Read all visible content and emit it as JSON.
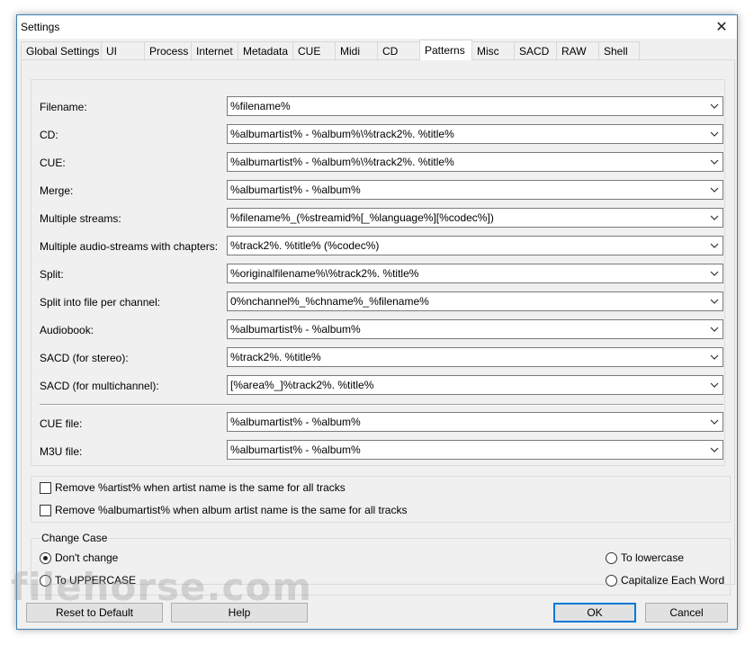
{
  "window": {
    "title": "Settings"
  },
  "tabs": [
    {
      "label": "Global Settings"
    },
    {
      "label": "UI"
    },
    {
      "label": "Process"
    },
    {
      "label": "Internet"
    },
    {
      "label": "Metadata"
    },
    {
      "label": "CUE"
    },
    {
      "label": "Midi"
    },
    {
      "label": "CD"
    },
    {
      "label": "Patterns",
      "active": true
    },
    {
      "label": "Misc"
    },
    {
      "label": "SACD"
    },
    {
      "label": "RAW"
    },
    {
      "label": "Shell"
    }
  ],
  "patterns": [
    {
      "label": "Filename:",
      "value": "%filename%"
    },
    {
      "label": "CD:",
      "value": "%albumartist% - %album%\\%track2%. %title%"
    },
    {
      "label": "CUE:",
      "value": "%albumartist% - %album%\\%track2%. %title%"
    },
    {
      "label": "Merge:",
      "value": "%albumartist% - %album%"
    },
    {
      "label": "Multiple streams:",
      "value": "%filename%_(%streamid%[_%language%][%codec%])"
    },
    {
      "label": "Multiple audio-streams with chapters:",
      "value": "%track2%. %title% (%codec%)"
    },
    {
      "label": "Split:",
      "value": "%originalfilename%\\%track2%. %title%"
    },
    {
      "label": "Split into file per channel:",
      "value": "0%nchannel%_%chname%_%filename%"
    },
    {
      "label": "Audiobook:",
      "value": "%albumartist% - %album%"
    },
    {
      "label": "SACD (for stereo):",
      "value": "%track2%. %title%"
    },
    {
      "label": "SACD (for multichannel):",
      "value": "[%area%_]%track2%. %title%"
    }
  ],
  "file_patterns": [
    {
      "label": "CUE file:",
      "value": "%albumartist% - %album%"
    },
    {
      "label": "M3U file:",
      "value": "%albumartist% - %album%"
    }
  ],
  "options": {
    "remove_artist": "Remove %artist% when artist name is the same for all tracks",
    "remove_albumartist": "Remove %albumartist% when album artist name is the same for all tracks"
  },
  "change_case": {
    "legend": "Change Case",
    "dont_change": "Don't change",
    "uppercase": "To UPPERCASE",
    "lowercase": "To lowercase",
    "capitalize": "Capitalize Each Word",
    "selected": "dont_change"
  },
  "buttons": {
    "reset": "Reset to Default",
    "help": "Help",
    "ok": "OK",
    "cancel": "Cancel"
  },
  "watermark": "filehorse.com"
}
